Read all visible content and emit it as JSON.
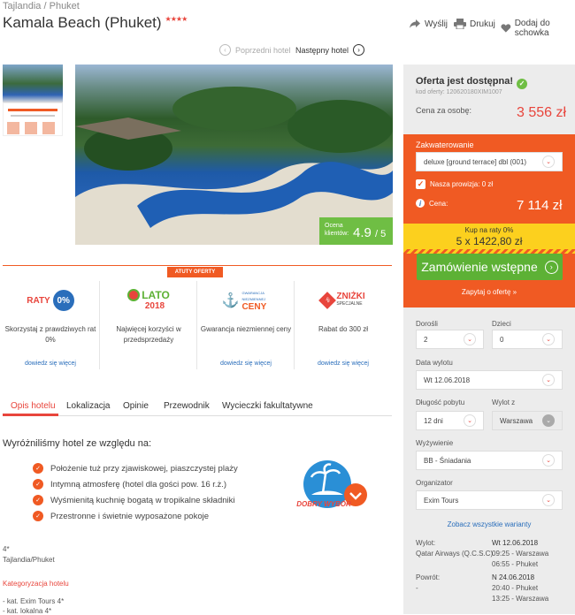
{
  "breadcrumb": {
    "country": "Tajlandia",
    "sep": "/",
    "region": "Phuket"
  },
  "title": "Kamala Beach (Phuket)",
  "stars": "★★★★",
  "actions": {
    "share": "Wyślij",
    "print": "Drukuj",
    "save": "Dodaj do schowka"
  },
  "hotel_nav": {
    "prev": "Poprzedni hotel",
    "next": "Następny hotel"
  },
  "gallery": {
    "rating_label": "Ocena klientów:",
    "rating_value": "4.9",
    "rating_max": "/ 5"
  },
  "offer": {
    "status": "Oferta jest dostępna!",
    "code": "kod oferty: 120620180XIM1007",
    "price_per_person_label": "Cena za osobę:",
    "price_per_person": "3 556 zł",
    "accommodation_label": "Zakwaterowanie",
    "accommodation_value": "deluxe [ground terrace] dbl (001)",
    "commission_label": "Nasza prowizja:",
    "commission_value": "0 zł",
    "price_label": "Cena:",
    "price_total": "7 114 zł",
    "installments_line1": "Kup na raty 0%",
    "installments_line2": "5 x 1422,80 zł",
    "order_button": "Zamówienie wstępne",
    "ask_link": "Zapytaj o ofertę »"
  },
  "form": {
    "adults_label": "Dorośli",
    "adults_value": "2",
    "children_label": "Dzieci",
    "children_value": "0",
    "departure_date_label": "Data wylotu",
    "departure_date_value": "Wt 12.06.2018",
    "stay_length_label": "Długość pobytu",
    "stay_length_value": "12 dni",
    "departure_from_label": "Wylot z",
    "departure_from_value": "Warszawa",
    "board_label": "Wyżywienie",
    "board_value": "BB - Śniadania",
    "organizer_label": "Organizator",
    "organizer_value": "Exim Tours",
    "all_variants_link": "Zobacz wszystkie warianty"
  },
  "flights": {
    "out_label": "Wylot:",
    "out_date": "Wt 12.06.2018",
    "airline": "Qatar Airways (Q.C.S.C)",
    "out_dep": "09:25 - Warszawa",
    "out_arr": "06:55 - Phuket",
    "ret_label": "Powrót:",
    "ret_dash": "-",
    "ret_date": "N 24.06.2018",
    "ret_dep": "20:40 - Phuket",
    "ret_arr": "13:25 - Warszawa"
  },
  "advantages": {
    "header": "ATUTY OFERTY",
    "more": "dowiedz się więcej",
    "items": [
      {
        "badge": "RATY",
        "badge2": "0%",
        "desc": "Skorzystaj z prawdziwych rat 0%"
      },
      {
        "badge": "LATO",
        "badge2": "2018",
        "desc": "Najwięcej korzyści w przedsprzedaży"
      },
      {
        "badge": "GWARANCJA NIEZMIENNEJ",
        "badge2": "CENY",
        "desc": "Gwarancja niezmiennej ceny"
      },
      {
        "badge": "ZNIŻKI",
        "badge2": "SPECJALNE",
        "desc": "Rabat do 300 zł"
      }
    ]
  },
  "tabs": [
    "Opis hotelu",
    "Lokalizacja",
    "Opinie",
    "Przewodnik",
    "Wycieczki fakultatywne"
  ],
  "description": {
    "heading": "Wyróżniliśmy hotel ze względu na:",
    "features": [
      "Położenie tuż przy zjawiskowej, piaszczystej plaży",
      "Intymną atmosferę (hotel dla gości pow. 16 r.ż.)",
      "Wyśmienitą kuchnię bogatą w tropikalne składniki",
      "Przestronne i świetnie wyposażone pokoje"
    ],
    "badge": "DOBRY WYBÓR",
    "stars_line": "4*",
    "location_line": "Tajlandia/Phuket",
    "category_heading": "Kategoryzacja hotelu",
    "cat1": "- kat. Exim Tours 4*",
    "cat2": "- kat. lokalna 4*"
  },
  "colors": {
    "accent": "#e8453c",
    "orange": "#f05a23",
    "green": "#5db135",
    "yellow": "#fcd01e",
    "link": "#2a6ebb"
  }
}
